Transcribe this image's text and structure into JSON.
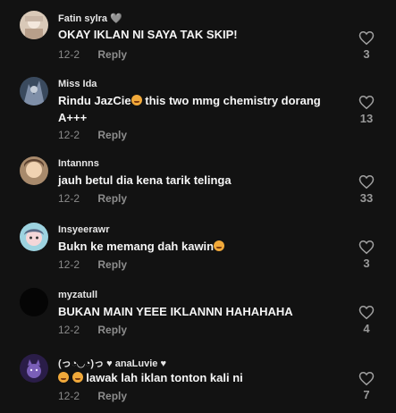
{
  "comments": [
    {
      "username": "Fatin sylra",
      "badge": "🩶",
      "text": "OKAY IKLAN NI SAYA TAK SKIP!",
      "date": "12-2",
      "reply": "Reply",
      "likes": "3"
    },
    {
      "username": "Miss Ida",
      "text_before": "Rindu JazCie",
      "text_after": " this two mmg chemistry dorang A+++",
      "date": "12-2",
      "reply": "Reply",
      "likes": "13"
    },
    {
      "username": "Intannns",
      "text": "jauh betul dia kena tarik telinga",
      "date": "12-2",
      "reply": "Reply",
      "likes": "33"
    },
    {
      "username": "Insyeerawr",
      "text_before": "Bukn ke memang dah kawin",
      "date": "12-2",
      "reply": "Reply",
      "likes": "3"
    },
    {
      "username": "myzatull",
      "text": "BUKAN MAIN YEEE IKLANNN HAHAHAHA",
      "date": "12-2",
      "reply": "Reply",
      "likes": "4"
    },
    {
      "username": "(っ◔◡◔)っ ♥ anaLuvie ♥",
      "text": " lawak lah iklan tonton kali ni",
      "date": "12-2",
      "reply": "Reply",
      "likes": "7"
    }
  ],
  "icons": {
    "like": "heart-outline-icon",
    "emoji": "smiling-face-icon"
  }
}
